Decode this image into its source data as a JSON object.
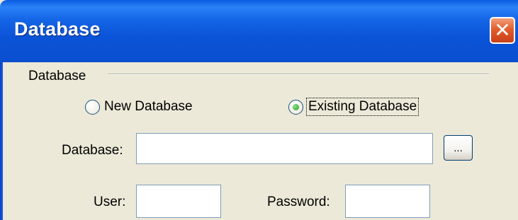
{
  "window": {
    "title": "Database",
    "close_glyph": "✕"
  },
  "group": {
    "label": "Database"
  },
  "options": {
    "new_database": {
      "label": "New Database",
      "selected": false
    },
    "existing_database": {
      "label": "Existing Database",
      "selected": true
    }
  },
  "fields": {
    "database": {
      "label": "Database:",
      "value": ""
    },
    "browse_label": "...",
    "user": {
      "label": "User:",
      "value": ""
    },
    "password": {
      "label": "Password:",
      "value": ""
    }
  }
}
